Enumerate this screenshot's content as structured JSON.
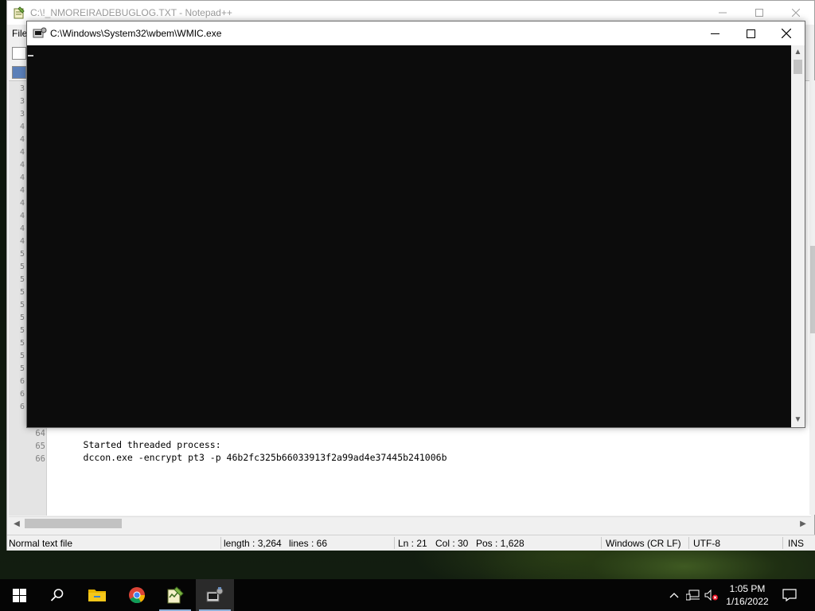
{
  "notepad": {
    "title": "C:\\!_NMOREIRADEBUGLOG.TXT - Notepad++",
    "menu_first": "File",
    "line_fragments": [
      "3",
      "3",
      "3",
      "4",
      "4",
      "4",
      "4",
      "4",
      "4",
      "4",
      "4",
      "4",
      "4",
      "5",
      "5",
      "5",
      "5",
      "5",
      "5",
      "5",
      "5",
      "5",
      "5",
      "6",
      "6",
      "6"
    ],
    "lines": [
      {
        "num": "64",
        "text": "Started threaded process:"
      },
      {
        "num": "65",
        "text": "dccon.exe -encrypt pt3 -p 46b2fc325b66033913f2a99ad4e37445b241006b"
      },
      {
        "num": "66",
        "text": ""
      }
    ],
    "status": {
      "file_type": "Normal text file",
      "length": "length : 3,264",
      "lines": "lines : 66",
      "ln": "Ln : 21",
      "col": "Col : 30",
      "pos": "Pos : 1,628",
      "eol": "Windows (CR LF)",
      "encoding": "UTF-8",
      "mode": "INS"
    }
  },
  "console": {
    "title": "C:\\Windows\\System32\\wbem\\WMIC.exe"
  },
  "taskbar": {
    "apps": [
      "start-icon",
      "search-icon",
      "file-explorer-icon",
      "chrome-icon",
      "notepad-plus-plus-icon",
      "wmic-console-icon"
    ],
    "active_app": "wmic-console-icon",
    "tray": {
      "time": "1:05 PM",
      "date": "1/16/2022"
    }
  },
  "colors": {
    "console_bg": "#0c0c0c",
    "taskbar_bg": "#050505",
    "status_bar_bg": "#f0f0f0"
  }
}
